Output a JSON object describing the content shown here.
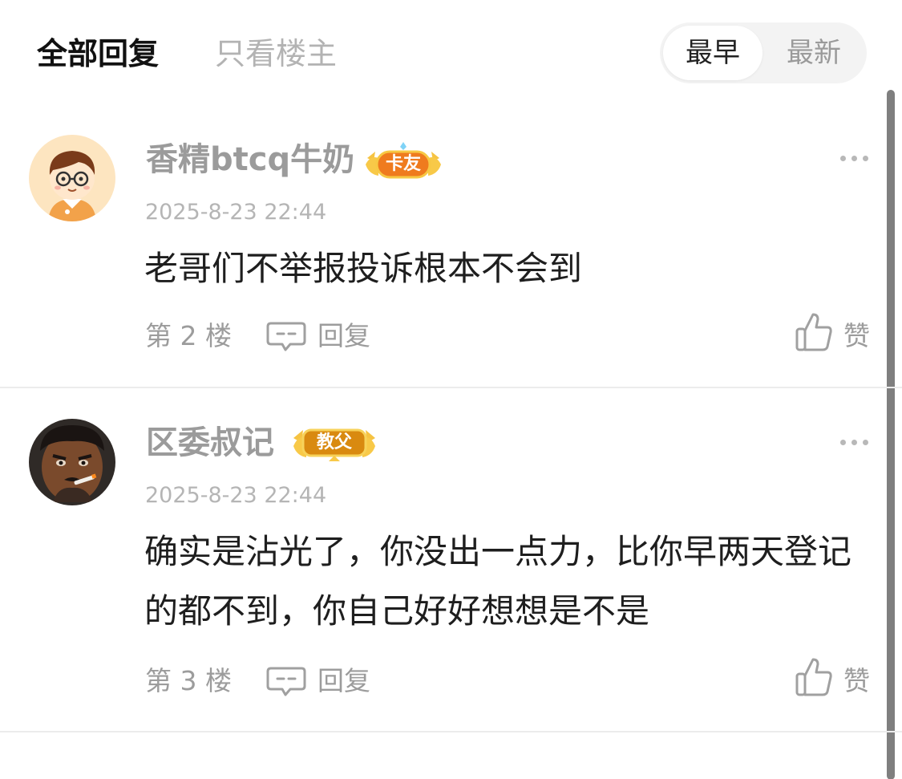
{
  "tabs": {
    "all_replies": "全部回复",
    "op_only": "只看楼主"
  },
  "sort": {
    "earliest": "最早",
    "newest": "最新",
    "selected": "最早"
  },
  "comments": [
    {
      "username": "香精btcq牛奶",
      "badge": "卡友",
      "badge_color": "#f0841f",
      "timestamp": "2025-8-23 22:44",
      "content": "老哥们不举报投诉根本不会到",
      "floor": "第 2 楼",
      "reply_label": "回复",
      "like_label": "赞",
      "avatar_icon": "cartoon-boy-glasses-avatar"
    },
    {
      "username": "区委叔记",
      "badge": "教父",
      "badge_color": "#d98a10",
      "timestamp": "2025-8-23 22:44",
      "content": "确实是沾光了，你没出一点力，比你早两天登记的都不到，你自己好好想想是不是",
      "floor": "第 3 楼",
      "reply_label": "回复",
      "like_label": "赞",
      "avatar_icon": "man-smoking-avatar"
    }
  ],
  "colors": {
    "accent_text": "#111111",
    "muted_text": "#9c9c9c",
    "divider": "#ececec"
  }
}
